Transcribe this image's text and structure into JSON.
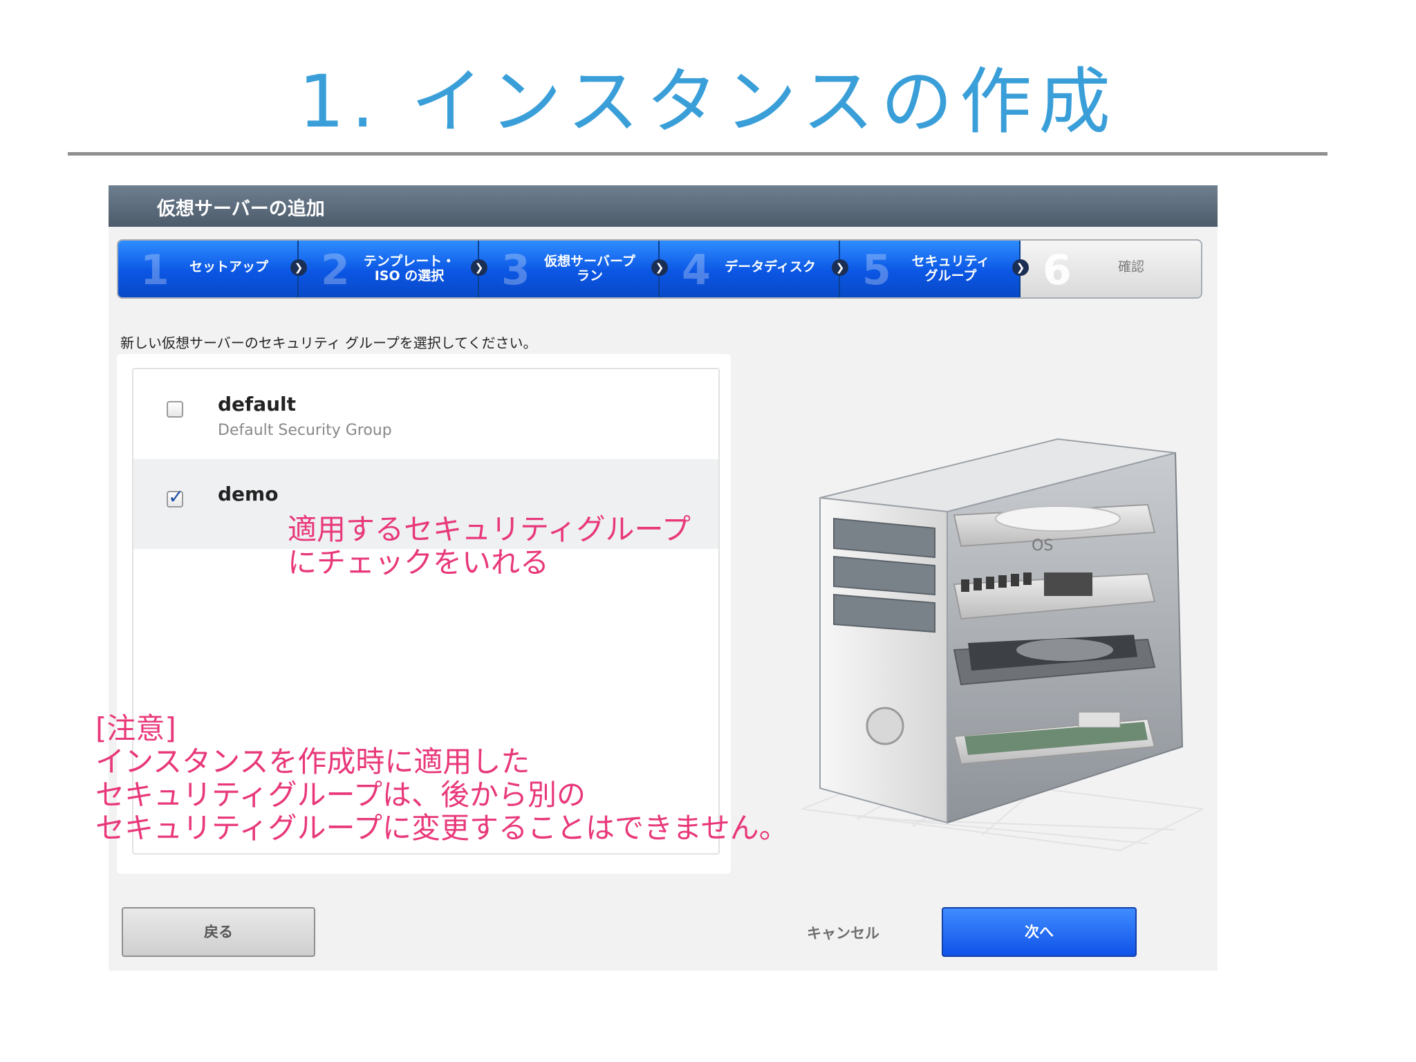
{
  "slide": {
    "title": "1. インスタンスの作成"
  },
  "dialog": {
    "title": "仮想サーバーの追加",
    "steps": [
      {
        "num": "1",
        "label": "セットアップ",
        "state": "active"
      },
      {
        "num": "2",
        "label": "テンプレート・\nISO の選択",
        "state": "active"
      },
      {
        "num": "3",
        "label": "仮想サーバープ\nラン",
        "state": "active"
      },
      {
        "num": "4",
        "label": "データディスク",
        "state": "active"
      },
      {
        "num": "5",
        "label": "セキュリティ\nグループ",
        "state": "active"
      },
      {
        "num": "6",
        "label": "確認",
        "state": "inactive"
      }
    ],
    "instruction": "新しい仮想サーバーのセキュリティ グループを選択してください。",
    "groups": [
      {
        "name": "default",
        "description": "Default Security Group",
        "checked": false
      },
      {
        "name": "demo",
        "description": "",
        "checked": true
      }
    ],
    "buttons": {
      "back": "戻る",
      "cancel": "キャンセル",
      "next": "次へ"
    },
    "server_labels": {
      "os": "OS"
    }
  },
  "annotations": {
    "note1": [
      "適用するセキュリティグループ",
      "にチェックをいれる"
    ],
    "note2": [
      "[注意]",
      "インスタンスを作成時に適用した",
      "セキュリティグループは、後から別の",
      "セキュリティグループに変更することはできません。"
    ]
  },
  "colors": {
    "title": "#3a9fd8",
    "annotation": "#e8387a",
    "step_active": "#0b56e4"
  }
}
